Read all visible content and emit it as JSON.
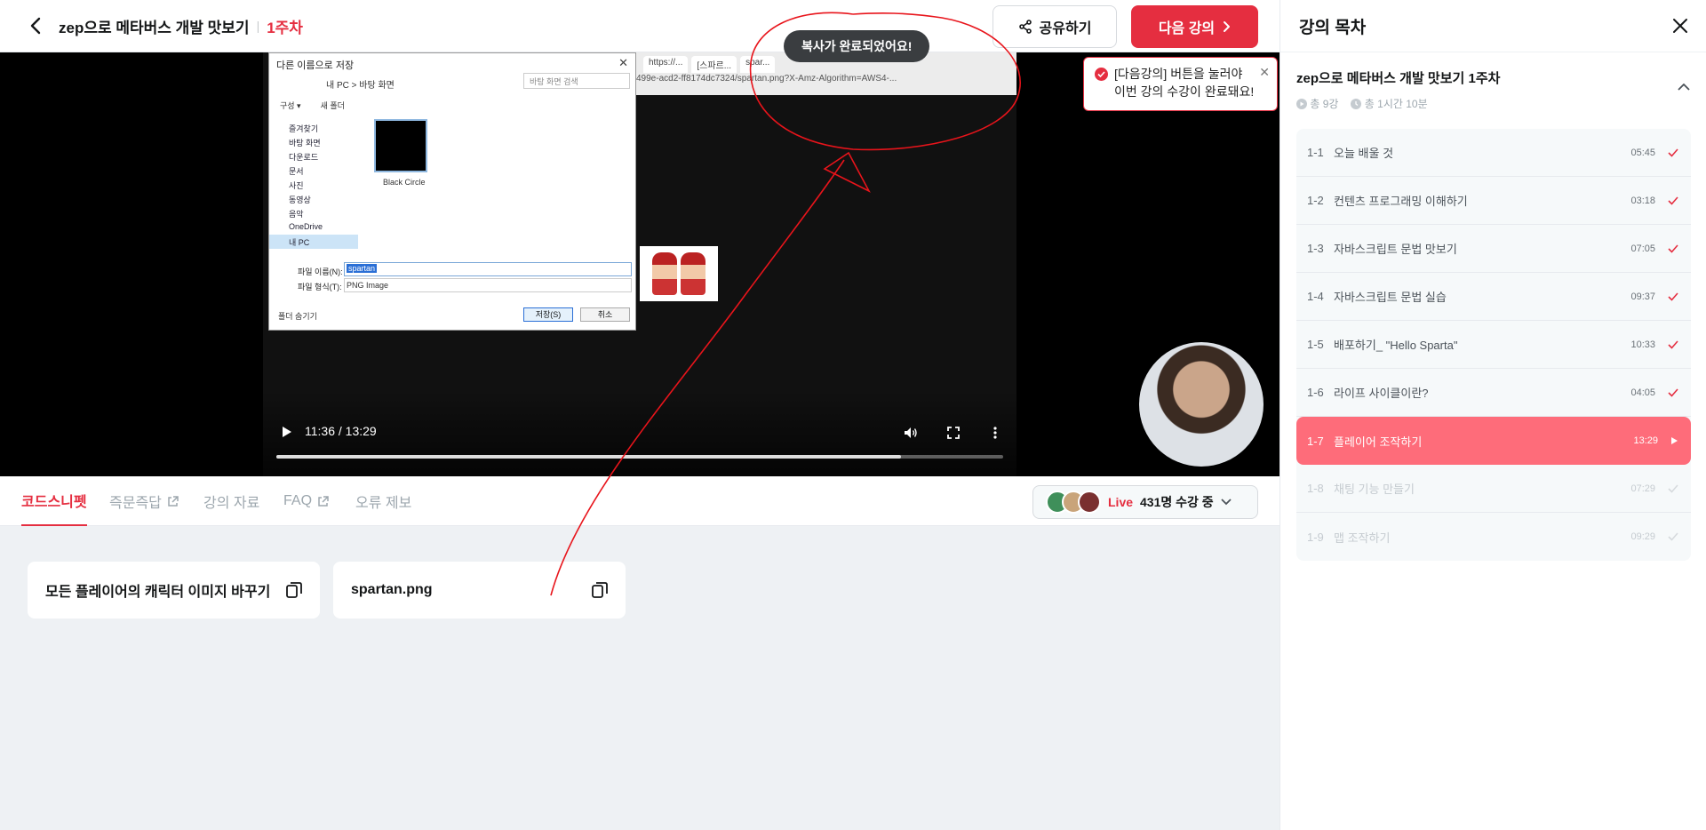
{
  "header": {
    "course_title": "zep으로 메타버스 개발 맛보기",
    "separator": "|",
    "week": "1주차",
    "share_label": "공유하기",
    "next_label": "다음 강의"
  },
  "video": {
    "toast": "복사가 완료되었어요!",
    "current_time": "11:36",
    "total_time": "13:29",
    "time_display": "11:36 / 13:29",
    "progress_fraction": 0.86,
    "browser_tabs": [
      "https://...",
      "[스파르...",
      "spar..."
    ],
    "browser_url": "499e-acd2-ff8174dc7324/spartan.png?X-Amz-Algorithm=AWS4-...",
    "dialog": {
      "title": "다른 이름으로 저장",
      "path": "내 PC  >  바탕 화면",
      "search_placeholder": "바탕 화면 검색",
      "toolbar": [
        "구성 ▾",
        "새 폴더"
      ],
      "sidebar": [
        "즐겨찾기",
        "바탕 화면",
        "다운로드",
        "문서",
        "사진",
        "동영상",
        "음악",
        "OneDrive",
        "내 PC"
      ],
      "thumb_label": "Black Circle",
      "filename_label": "파일 이름(N):",
      "filename_value": "spartan",
      "type_label": "파일 형식(T):",
      "type_value": "PNG Image",
      "hide_folders": "폴더 숨기기",
      "save": "저장(S)",
      "cancel": "취소"
    }
  },
  "tabs": [
    {
      "label": "코드스니펫",
      "active": true
    },
    {
      "label": "즉문즉답"
    },
    {
      "label": "강의 자료"
    },
    {
      "label": "FAQ"
    },
    {
      "label": "오류 제보"
    }
  ],
  "live": {
    "label": "Live",
    "count": "431명 수강 중"
  },
  "snippets": [
    {
      "label": "모든 플레이어의 캐릭터 이미지 바꾸기"
    },
    {
      "label": "spartan.png"
    }
  ],
  "tooltip": {
    "line1": "[다음강의] 버튼을 눌러야",
    "line2": "이번 강의 수강이 완료돼요!"
  },
  "sidebar": {
    "title": "강의 목차",
    "course_title": "zep으로 메타버스 개발 맛보기 1주차",
    "lesson_count": "총 9강",
    "total_time": "총 1시간 10분",
    "lessons": [
      {
        "num": "1-1",
        "name": "오늘 배울 것",
        "dur": "05:45",
        "state": "done"
      },
      {
        "num": "1-2",
        "name": "컨텐츠 프로그래밍 이해하기",
        "dur": "03:18",
        "state": "done"
      },
      {
        "num": "1-3",
        "name": "자바스크립트 문법 맛보기",
        "dur": "07:05",
        "state": "done"
      },
      {
        "num": "1-4",
        "name": "자바스크립트 문법 실습",
        "dur": "09:37",
        "state": "done"
      },
      {
        "num": "1-5",
        "name": "배포하기_ \"Hello Sparta\"",
        "dur": "10:33",
        "state": "done"
      },
      {
        "num": "1-6",
        "name": "라이프 사이클이란?",
        "dur": "04:05",
        "state": "done"
      },
      {
        "num": "1-7",
        "name": "플레이어 조작하기",
        "dur": "13:29",
        "state": "active"
      },
      {
        "num": "1-8",
        "name": "채팅 기능 만들기",
        "dur": "07:29",
        "state": "locked"
      },
      {
        "num": "1-9",
        "name": "맵 조작하기",
        "dur": "09:29",
        "state": "locked"
      }
    ]
  },
  "colors": {
    "accent": "#e52e40",
    "active_lesson": "#fe6c7a",
    "annotation": "#e8141b"
  }
}
